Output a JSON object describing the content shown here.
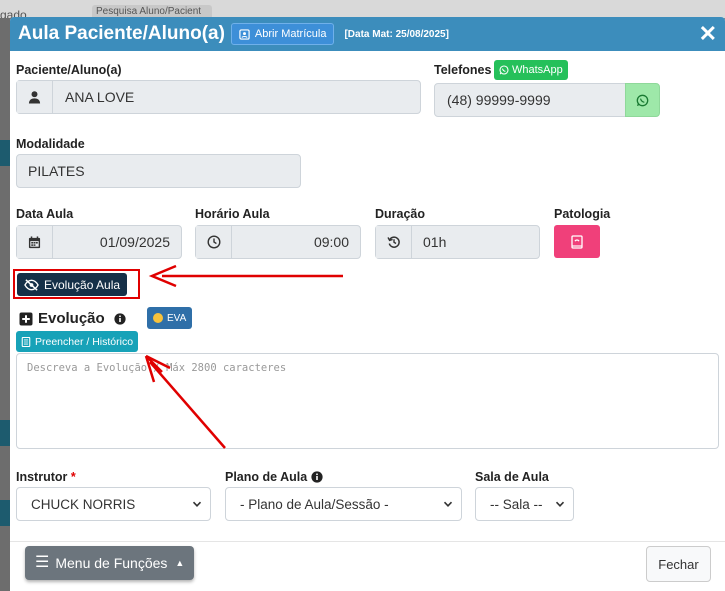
{
  "background": {
    "top_left_text": "gado",
    "tab_text": "Pesquisa Aluno/Pacient"
  },
  "header": {
    "title": "Aula Paciente/Aluno(a)",
    "open_enrollment_label": "Abrir Matrícula",
    "enrollment_date": "[Data Mat: 25/08/2025]"
  },
  "patient": {
    "label": "Paciente/Aluno(a)",
    "value": "ANA LOVE"
  },
  "phones": {
    "label": "Telefones",
    "whatsapp_label": "WhatsApp",
    "value": "(48) 99999-9999"
  },
  "modality": {
    "label": "Modalidade",
    "value": "PILATES"
  },
  "class_date": {
    "label": "Data Aula",
    "value": "01/09/2025"
  },
  "class_time": {
    "label": "Horário Aula",
    "value": "09:00"
  },
  "duration": {
    "label": "Duração",
    "value": "01h"
  },
  "pathology": {
    "label": "Patologia"
  },
  "evolution": {
    "toggle_label": "Evolução Aula",
    "title": "Evolução",
    "eva_label": "EVA",
    "fill_history_label": "Preencher / Histórico",
    "placeholder": "Descreva a Evolução / Máx 2800 caracteres"
  },
  "instructor": {
    "label": "Instrutor",
    "required_mark": "*",
    "value": "CHUCK NORRIS"
  },
  "lesson_plan": {
    "label": "Plano de Aula",
    "value": "- Plano de Aula/Sessão -"
  },
  "room": {
    "label": "Sala de Aula",
    "value": "-- Sala --"
  },
  "footer": {
    "menu_label": "Menu de Funções",
    "close_label": "Fechar"
  },
  "colors": {
    "header": "#3c8dbc",
    "whatsapp": "#25c05a",
    "pathology": "#f0407a",
    "evolution_button": "#153048",
    "annotation": "#e00000"
  },
  "icons": {
    "patient": "user-icon",
    "date": "calendar-icon",
    "time": "clock-icon",
    "duration": "history-icon",
    "pathology": "book-icon",
    "evolution_toggle": "eye-slash-icon"
  }
}
